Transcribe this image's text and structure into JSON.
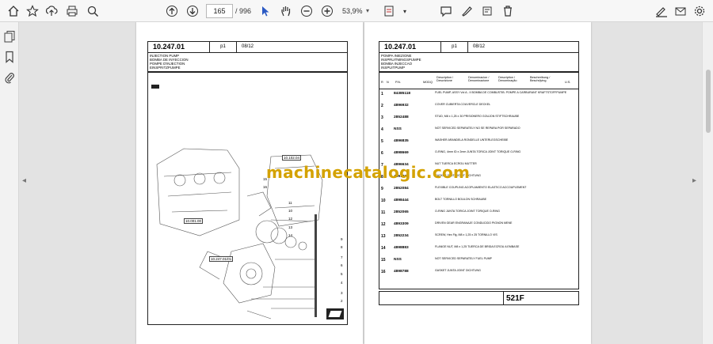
{
  "toolbar": {
    "page_current": "165",
    "page_total": "/ 996",
    "zoom": "53,9%",
    "icons": [
      "home-icon",
      "bookmark-star-icon",
      "upload-icon",
      "print-icon",
      "zoom-search-icon",
      "page-up-icon",
      "page-down-icon",
      "cursor-icon",
      "hand-icon",
      "zoom-out-icon",
      "zoom-in-icon",
      "fit-page-icon",
      "comment-icon",
      "highlight-icon",
      "stamp-icon",
      "delete-icon",
      "sign-icon",
      "email-icon",
      "settings-icon"
    ]
  },
  "sidebar": {
    "icons": [
      "pages-icon",
      "bookmarks-icon",
      "attachments-icon"
    ]
  },
  "left_page": {
    "code": "10.247.01",
    "page_label": "p1",
    "date": "08/12",
    "title_lines": [
      "INJECTION PUMP",
      "BOMBA DE INYECCION",
      "POMPE D'INJECTION",
      "EINSPRITZPUMPE"
    ],
    "callouts": [
      "10.102.04",
      "15",
      "16",
      "11",
      "10",
      "12",
      "13",
      "14",
      "9",
      "8",
      "7",
      "6",
      "5",
      "4",
      "3",
      "2",
      "1",
      "10.001.00",
      "10.247.01/01"
    ]
  },
  "right_page": {
    "code": "10.247.01",
    "page_label": "p1",
    "date": "08/12",
    "title_lines": [
      "POMPA INIEZIONE",
      "INSPRUITMINGSPUMPE",
      "BOMBA INJECCAO",
      "INSPUITPUMP"
    ],
    "col_headers": [
      "R",
      "N",
      "P.N.",
      "MOD",
      "Q",
      "Description / Descrizione",
      "Denominacion / Denominazione",
      "Description / Denominação",
      "Beschreibung / Beschrijving",
      "U.S."
    ],
    "rows": [
      {
        "idx": "1",
        "pn": "84385118",
        "text": "FUEL PUMP, ASSY Vol A - II   BOMBA DE COMBUSTIB.  POMPE A CARBURANT  KRAFTSTOFFPUMPE"
      },
      {
        "idx": "2",
        "pn": "4896932",
        "text": "COVER   CUBIERTA   COUVERCLE   DECKEL"
      },
      {
        "idx": "3",
        "pn": "2852488",
        "text": "STUD, M8 x 1,25 x 30  PRISIONERO  GOUJON  STIFTSCHRAUBE"
      },
      {
        "idx": "4",
        "pn": "NSS",
        "text": "NOT SERVICED SEPARATELY  NO SE REPARA POR SEPARADO"
      },
      {
        "idx": "5",
        "pn": "4896835",
        "text": "WASHER  ARANDELA  RONDELLE  UNTERLEGSCHEIBE"
      },
      {
        "idx": "6",
        "pn": "4898669",
        "text": "O-RING, 4mm ID x 2mm  JUNTA TORICA  JOINT TORIQUE  O-RING"
      },
      {
        "idx": "7",
        "pn": "4896634",
        "text": "NUT  TUERCA  ECROU  MUTTER"
      },
      {
        "idx": "8",
        "pn": "4891305",
        "text": "GASKET  JUNTA  JOINT  DICHTUNG"
      },
      {
        "idx": "9",
        "pn": "2852084",
        "text": "FLEXIBLE COUPLING  ACOPLAMIENTO ELASTICO  ACCOUPLEMENT"
      },
      {
        "idx": "10",
        "pn": "4898444",
        "text": "BOLT  TORNILLO  BOULON  SCHRAUBE"
      },
      {
        "idx": "11",
        "pn": "2852065",
        "text": "O-RING  JUNTA TORICA  JOINT TORIQUE  O-RING"
      },
      {
        "idx": "12",
        "pn": "4893309",
        "text": "DRIVEN GEAR  ENGRANAJE CONDUCIDO  PIGNON MENE"
      },
      {
        "idx": "13",
        "pn": "2852234",
        "text": "SCREW, Hex Flg, M8 x 1,25 x 25  TORNILLO  VIS"
      },
      {
        "idx": "14",
        "pn": "4898883",
        "text": "FLANGE NUT, M8 x 1,25  TUERCA DE BRIDA  ECROU A EMBASE"
      },
      {
        "idx": "15",
        "pn": "NSS",
        "text": "NOT SERVICED SEPARATELY  FUEL PUMP"
      },
      {
        "idx": "16",
        "pn": "4898788",
        "text": "GASKET  JUNTA  JOINT  DICHTUNG"
      }
    ],
    "model": "521F"
  },
  "watermark": "machinecatalogic.com"
}
